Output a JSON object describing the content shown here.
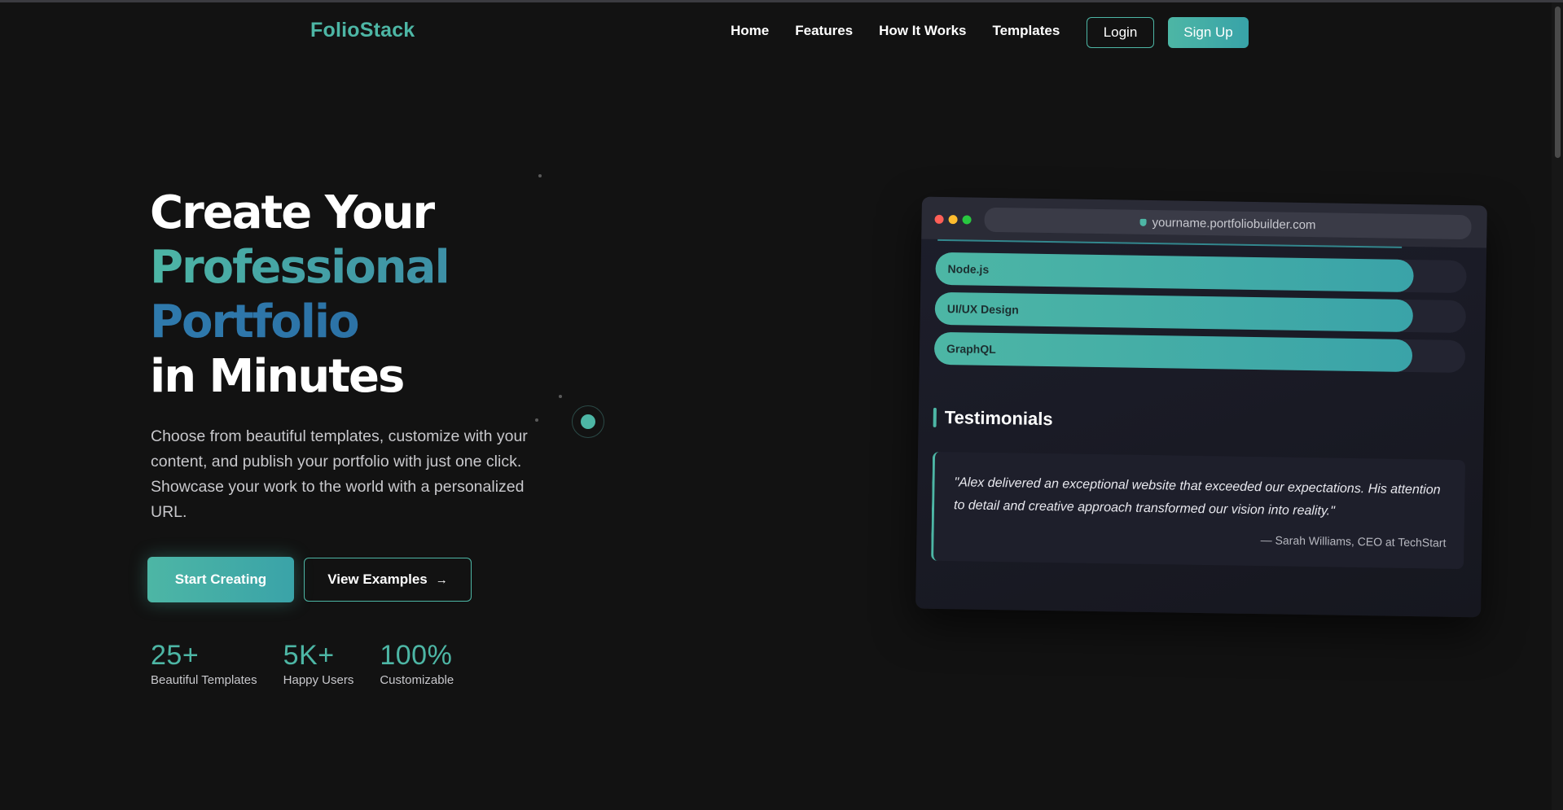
{
  "nav": {
    "logo": "FolioStack",
    "links": [
      "Home",
      "Features",
      "How It Works",
      "Templates"
    ],
    "login": "Login",
    "signup": "Sign Up"
  },
  "hero": {
    "headline_line1": "Create Your",
    "headline_line2": "Professional",
    "headline_line3": "Portfolio",
    "headline_line4": "in Minutes",
    "description": "Choose from beautiful templates, customize with your content, and publish your portfolio with just one click. Showcase your work to the world with a personalized URL.",
    "primary_button": "Start Creating",
    "secondary_button": "View Examples",
    "stats": [
      {
        "value": "25+",
        "label": "Beautiful Templates"
      },
      {
        "value": "5K+",
        "label": "Happy Users"
      },
      {
        "value": "100%",
        "label": "Customizable"
      }
    ]
  },
  "preview": {
    "url": "yourname.portfoliobuilder.com",
    "skills": [
      {
        "name": "Node.js",
        "level": 0.9
      },
      {
        "name": "UI/UX Design",
        "level": 0.9
      },
      {
        "name": "GraphQL",
        "level": 0.9
      }
    ],
    "section_title": "Testimonials",
    "testimonial_quote": "\"Alex delivered an exceptional website that exceeded our expectations. His attention to detail and creative approach transformed our vision into reality.\"",
    "testimonial_author": "— Sarah Williams, CEO at TechStart"
  },
  "colors": {
    "accent": "#4db6a5",
    "accent_alt": "#3aa3a8",
    "background": "#121212",
    "headline_blue": "#2f7aad"
  },
  "icons": {
    "view_examples": "arrow-right-icon",
    "url_lock": "lock-icon"
  }
}
